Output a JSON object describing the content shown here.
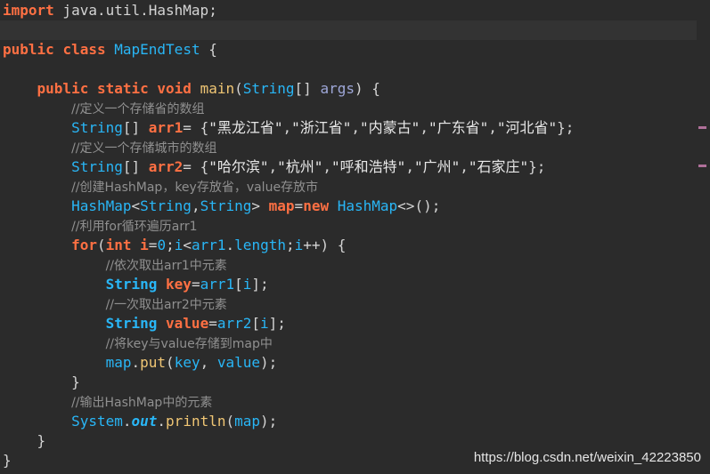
{
  "lines": [
    {
      "current": false,
      "tokens": [
        [
          "kw",
          "import"
        ],
        [
          "plain",
          " java.util.HashMap;"
        ]
      ]
    },
    {
      "current": true,
      "tokens": []
    },
    {
      "current": false,
      "tokens": [
        [
          "kw",
          "public"
        ],
        [
          "plain",
          " "
        ],
        [
          "kw",
          "class"
        ],
        [
          "plain",
          " "
        ],
        [
          "cls",
          "MapEndTest"
        ],
        [
          "plain",
          " {"
        ]
      ]
    },
    {
      "current": false,
      "tokens": []
    },
    {
      "current": false,
      "tokens": [
        [
          "plain",
          "    "
        ],
        [
          "kw",
          "public"
        ],
        [
          "plain",
          " "
        ],
        [
          "kw",
          "static"
        ],
        [
          "plain",
          " "
        ],
        [
          "kw",
          "void"
        ],
        [
          "plain",
          " "
        ],
        [
          "fn",
          "main"
        ],
        [
          "plain",
          "("
        ],
        [
          "typ",
          "String"
        ],
        [
          "plain",
          "[] "
        ],
        [
          "param",
          "args"
        ],
        [
          "plain",
          ") {"
        ]
      ]
    },
    {
      "current": false,
      "tokens": [
        [
          "plain",
          "        "
        ],
        [
          "cm",
          "//定义一个存储省的数组"
        ]
      ]
    },
    {
      "current": false,
      "tokens": [
        [
          "plain",
          "        "
        ],
        [
          "typ",
          "String"
        ],
        [
          "plain",
          "[] "
        ],
        [
          "var",
          "arr1"
        ],
        [
          "plain",
          "= {"
        ],
        [
          "str",
          "\"黑龙江省\""
        ],
        [
          "plain",
          ","
        ],
        [
          "str",
          "\"浙江省\""
        ],
        [
          "plain",
          ","
        ],
        [
          "str",
          "\"内蒙古\""
        ],
        [
          "plain",
          ","
        ],
        [
          "str",
          "\"广东省\""
        ],
        [
          "plain",
          ","
        ],
        [
          "str",
          "\"河北省\""
        ],
        [
          "plain",
          "};"
        ]
      ]
    },
    {
      "current": false,
      "tokens": [
        [
          "plain",
          "        "
        ],
        [
          "cm",
          "//定义一个存储城市的数组"
        ]
      ]
    },
    {
      "current": false,
      "tokens": [
        [
          "plain",
          "        "
        ],
        [
          "typ",
          "String"
        ],
        [
          "plain",
          "[] "
        ],
        [
          "var",
          "arr2"
        ],
        [
          "plain",
          "= {"
        ],
        [
          "str",
          "\"哈尔滨\""
        ],
        [
          "plain",
          ","
        ],
        [
          "str",
          "\"杭州\""
        ],
        [
          "plain",
          ","
        ],
        [
          "str",
          "\"呼和浩特\""
        ],
        [
          "plain",
          ","
        ],
        [
          "str",
          "\"广州\""
        ],
        [
          "plain",
          ","
        ],
        [
          "str",
          "\"石家庄\""
        ],
        [
          "plain",
          "};"
        ]
      ]
    },
    {
      "current": false,
      "tokens": [
        [
          "plain",
          "        "
        ],
        [
          "cm",
          "//创建HashMap，key存放省，value存放市"
        ]
      ]
    },
    {
      "current": false,
      "tokens": [
        [
          "plain",
          "        "
        ],
        [
          "typ",
          "HashMap"
        ],
        [
          "plain",
          "<"
        ],
        [
          "typ",
          "String"
        ],
        [
          "plain",
          ","
        ],
        [
          "typ",
          "String"
        ],
        [
          "plain",
          "> "
        ],
        [
          "var",
          "map"
        ],
        [
          "plain",
          "="
        ],
        [
          "kw",
          "new"
        ],
        [
          "plain",
          " "
        ],
        [
          "typ",
          "HashMap"
        ],
        [
          "plain",
          "<>();"
        ]
      ]
    },
    {
      "current": false,
      "tokens": [
        [
          "plain",
          "        "
        ],
        [
          "cm",
          "//利用for循环遍历arr1"
        ]
      ]
    },
    {
      "current": false,
      "tokens": [
        [
          "plain",
          "        "
        ],
        [
          "kw",
          "for"
        ],
        [
          "plain",
          "("
        ],
        [
          "kw",
          "int"
        ],
        [
          "plain",
          " "
        ],
        [
          "var",
          "i"
        ],
        [
          "plain",
          "="
        ],
        [
          "num",
          "0"
        ],
        [
          "plain",
          ";"
        ],
        [
          "fld",
          "i"
        ],
        [
          "plain",
          "<"
        ],
        [
          "fld",
          "arr1"
        ],
        [
          "plain",
          "."
        ],
        [
          "fld",
          "length"
        ],
        [
          "plain",
          ";"
        ],
        [
          "fld",
          "i"
        ],
        [
          "plain",
          "++) {"
        ]
      ]
    },
    {
      "current": false,
      "tokens": [
        [
          "plain",
          "            "
        ],
        [
          "cm",
          "//依次取出arr1中元素"
        ]
      ]
    },
    {
      "current": false,
      "tokens": [
        [
          "plain",
          "            "
        ],
        [
          "ty",
          "String"
        ],
        [
          "plain",
          " "
        ],
        [
          "var",
          "key"
        ],
        [
          "plain",
          "="
        ],
        [
          "fld",
          "arr1"
        ],
        [
          "plain",
          "["
        ],
        [
          "fld",
          "i"
        ],
        [
          "plain",
          "];"
        ]
      ]
    },
    {
      "current": false,
      "tokens": [
        [
          "plain",
          "            "
        ],
        [
          "cm",
          "//一次取出arr2中元素"
        ]
      ]
    },
    {
      "current": false,
      "tokens": [
        [
          "plain",
          "            "
        ],
        [
          "ty",
          "String"
        ],
        [
          "plain",
          " "
        ],
        [
          "var",
          "value"
        ],
        [
          "plain",
          "="
        ],
        [
          "fld",
          "arr2"
        ],
        [
          "plain",
          "["
        ],
        [
          "fld",
          "i"
        ],
        [
          "plain",
          "];"
        ]
      ]
    },
    {
      "current": false,
      "tokens": [
        [
          "plain",
          "            "
        ],
        [
          "cm",
          "//将key与value存储到map中"
        ]
      ]
    },
    {
      "current": false,
      "tokens": [
        [
          "plain",
          "            "
        ],
        [
          "fld",
          "map"
        ],
        [
          "plain",
          "."
        ],
        [
          "fn",
          "put"
        ],
        [
          "plain",
          "("
        ],
        [
          "fld",
          "key"
        ],
        [
          "plain",
          ", "
        ],
        [
          "fld",
          "value"
        ],
        [
          "plain",
          ");"
        ]
      ]
    },
    {
      "current": false,
      "tokens": [
        [
          "plain",
          "        }"
        ]
      ]
    },
    {
      "current": false,
      "tokens": [
        [
          "plain",
          "        "
        ],
        [
          "cm",
          "//输出HashMap中的元素"
        ]
      ]
    },
    {
      "current": false,
      "tokens": [
        [
          "plain",
          "        "
        ],
        [
          "typ",
          "System"
        ],
        [
          "plain",
          "."
        ],
        [
          "static-field",
          "out"
        ],
        [
          "plain",
          "."
        ],
        [
          "fn",
          "println"
        ],
        [
          "plain",
          "("
        ],
        [
          "fld",
          "map"
        ],
        [
          "plain",
          ");"
        ]
      ]
    },
    {
      "current": false,
      "tokens": [
        [
          "plain",
          "    }"
        ]
      ]
    },
    {
      "current": false,
      "tokens": [
        [
          "plain",
          "}"
        ]
      ]
    }
  ],
  "watermark": "https://blog.csdn.net/weixin_42223850",
  "colors": {
    "background": "#2b2b2b",
    "keyword": "#ff7043",
    "type": "#29b6f6",
    "comment": "#909090",
    "current_line": "#333333",
    "marker": "#b0709a"
  }
}
